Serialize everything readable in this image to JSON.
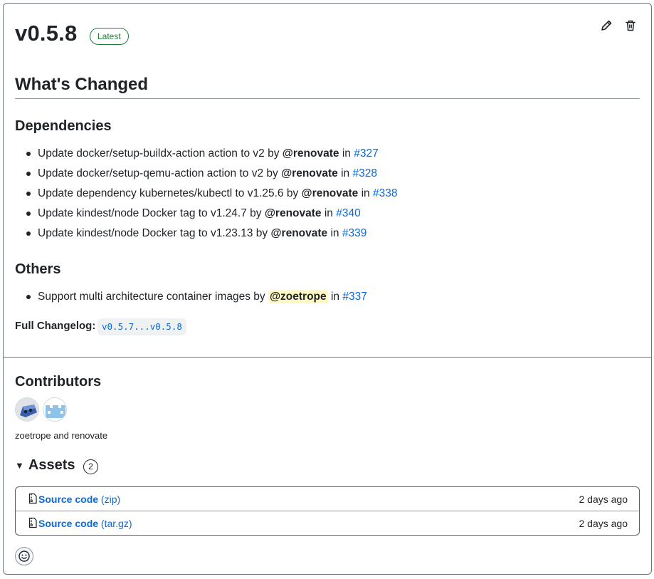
{
  "release": {
    "version": "v0.5.8",
    "badge": "Latest"
  },
  "actions": {
    "edit_icon": "pencil-icon",
    "delete_icon": "trash-icon"
  },
  "notes": {
    "heading": "What's Changed",
    "sections": [
      {
        "title": "Dependencies",
        "items": [
          {
            "text": "Update docker/setup-buildx-action action to v2 by ",
            "user": "@renovate",
            "in": " in ",
            "pr": "#327"
          },
          {
            "text": "Update docker/setup-qemu-action action to v2 by ",
            "user": "@renovate",
            "in": " in ",
            "pr": "#328"
          },
          {
            "text": "Update dependency kubernetes/kubectl to v1.25.6 by ",
            "user": "@renovate",
            "in": " in ",
            "pr": "#338"
          },
          {
            "text": "Update kindest/node Docker tag to v1.24.7 by ",
            "user": "@renovate",
            "in": " in ",
            "pr": "#340"
          },
          {
            "text": "Update kindest/node Docker tag to v1.23.13 by ",
            "user": "@renovate",
            "in": " in ",
            "pr": "#339"
          }
        ]
      },
      {
        "title": "Others",
        "items": [
          {
            "text": "Support multi architecture container images by ",
            "user": "@zoetrope",
            "in": " in ",
            "pr": "#337"
          }
        ]
      }
    ],
    "full_changelog_label": "Full Changelog:",
    "full_changelog_link": "v0.5.7...v0.5.8"
  },
  "contributors": {
    "heading": "Contributors",
    "names": "zoetrope and renovate"
  },
  "assets": {
    "heading": "Assets",
    "count": "2",
    "rows": [
      {
        "name": "Source code",
        "ext": "(zip)",
        "date": "2 days ago"
      },
      {
        "name": "Source code",
        "ext": "(tar.gz)",
        "date": "2 days ago"
      }
    ]
  },
  "colors": {
    "link": "#0969da",
    "badge": "#1a7f37",
    "highlight": "#fff8c5"
  }
}
